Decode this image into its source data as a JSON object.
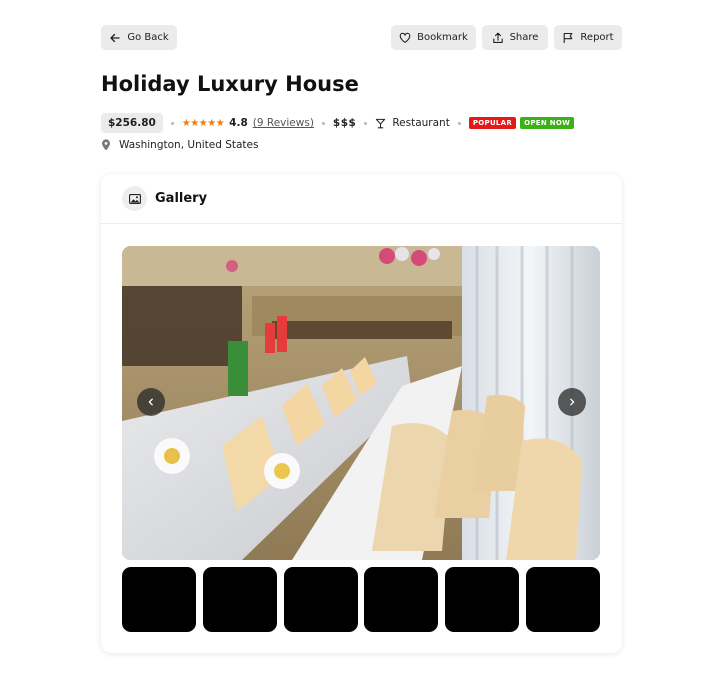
{
  "header": {
    "back_label": "Go Back",
    "bookmark_label": "Bookmark",
    "share_label": "Share",
    "report_label": "Report"
  },
  "listing": {
    "title": "Holiday Luxury House",
    "price": "$256.80",
    "stars": "★★★★★",
    "rating": "4.8",
    "reviews_label": "(9 Reviews)",
    "cost_level": "$$$",
    "category": "Restaurant",
    "badges": {
      "popular": "POPULAR",
      "open": "OPEN NOW"
    },
    "location": "Washington, United States"
  },
  "gallery": {
    "title": "Gallery",
    "thumbnail_count": 6
  },
  "colors": {
    "star": "#f07d12",
    "badge_popular": "#e41919",
    "badge_open": "#3bb116",
    "button_bg": "#ebebeb"
  },
  "icons": {
    "back": "arrow-left-icon",
    "bookmark": "heart-icon",
    "share": "share-icon",
    "report": "flag-icon",
    "category": "cocktail-glass-icon",
    "location": "map-pin-icon",
    "gallery": "image-icon",
    "prev": "chevron-left-icon",
    "next": "chevron-right-icon"
  }
}
